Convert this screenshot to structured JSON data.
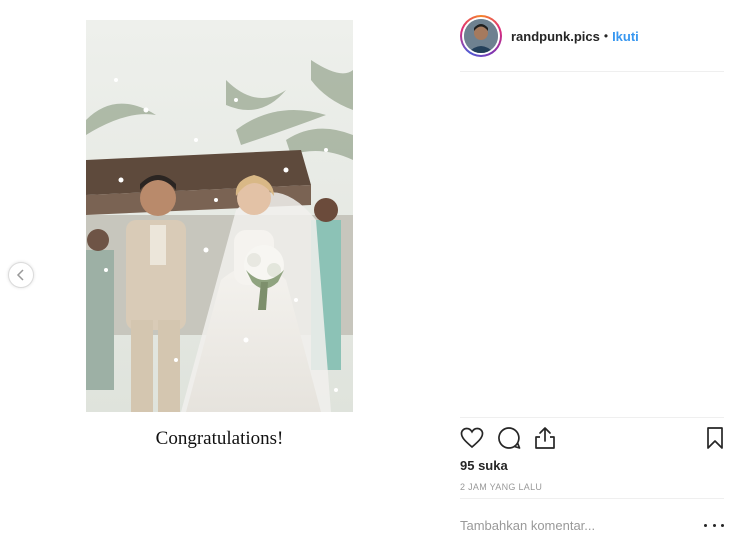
{
  "post": {
    "username": "randpunk.pics",
    "separator": "•",
    "follow_label": "Ikuti",
    "caption_text": "Congratulations!",
    "likes_text": "95 suka",
    "timestamp": "2 JAM YANG LALU",
    "comment_placeholder": "Tambahkan komentar..."
  },
  "icons": {
    "prev": "chevron-left-icon",
    "like": "heart-icon",
    "comment": "comment-bubble-icon",
    "share": "share-icon",
    "save": "bookmark-icon",
    "more": "more-options-icon"
  },
  "colors": {
    "link": "#3897f0",
    "text": "#262626",
    "muted": "#999999",
    "divider": "#efefef"
  }
}
